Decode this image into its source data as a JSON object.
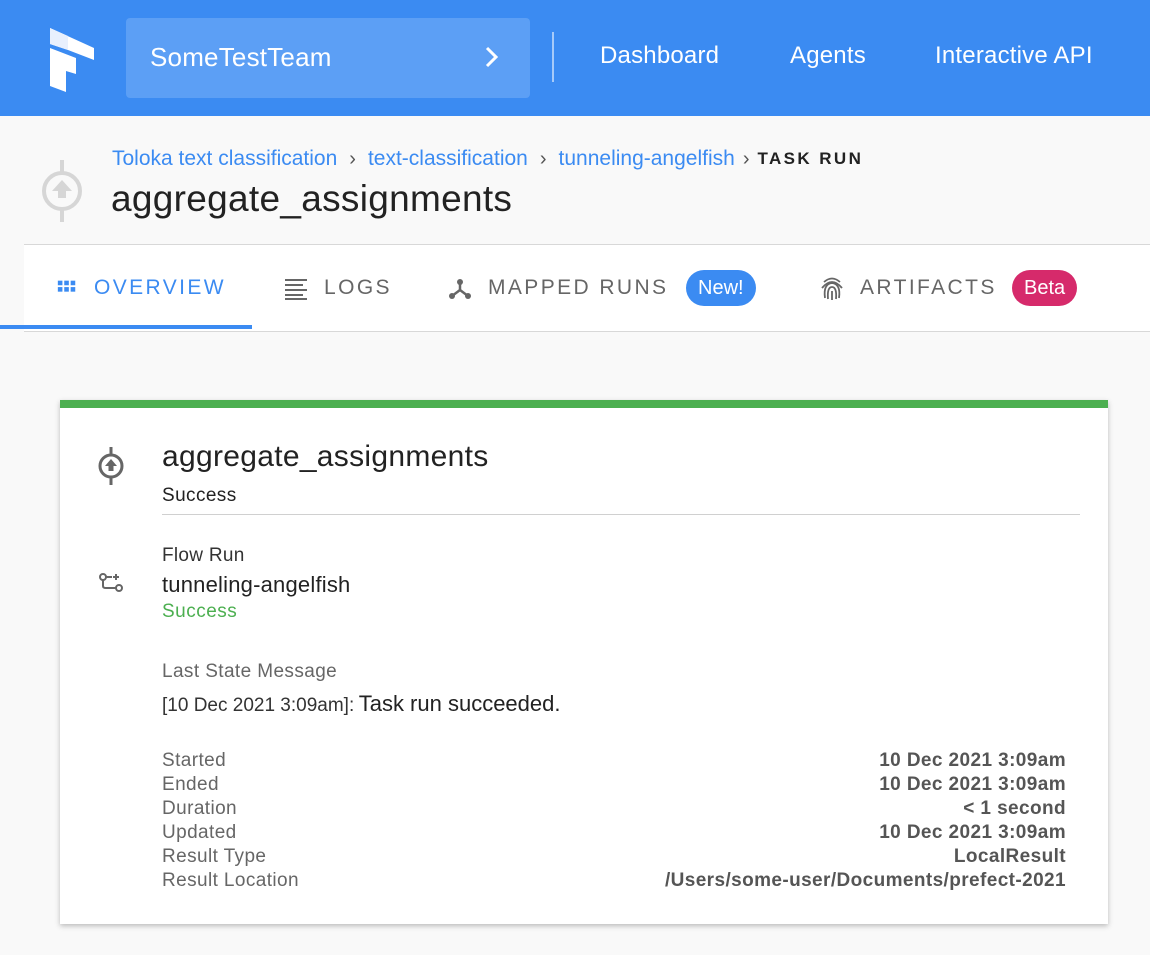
{
  "topbar": {
    "team_name": "SomeTestTeam",
    "nav": [
      "Dashboard",
      "Agents",
      "Interactive API"
    ],
    "icons": {
      "logo": "prefect-logo",
      "team_chevron": "chevron-right-icon"
    }
  },
  "header": {
    "breadcrumb": [
      "Toloka text classification",
      "text-classification",
      "tunneling-angelfish"
    ],
    "current": "TASK RUN",
    "title": "aggregate_assignments"
  },
  "tabs": [
    {
      "label": "OVERVIEW",
      "icon": "grid-icon",
      "active": true
    },
    {
      "label": "LOGS",
      "icon": "lines-icon",
      "active": false
    },
    {
      "label": "MAPPED RUNS",
      "icon": "mapped-icon",
      "badge": "New!",
      "active": false
    },
    {
      "label": "ARTIFACTS",
      "icon": "fingerprint-icon",
      "badge": "Beta",
      "active": false
    }
  ],
  "card": {
    "title": "aggregate_assignments",
    "state": "Success",
    "flow_run_label": "Flow Run",
    "flow_run_name": "tunneling-angelfish",
    "flow_run_state": "Success",
    "last_state_label": "Last State Message",
    "last_state_time": "[10 Dec 2021 3:09am]:",
    "last_state_text": "Task run succeeded.",
    "details": [
      {
        "key": "Started",
        "value": "10 Dec 2021 3:09am"
      },
      {
        "key": "Ended",
        "value": "10 Dec 2021 3:09am"
      },
      {
        "key": "Duration",
        "value": "< 1 second"
      },
      {
        "key": "Updated",
        "value": "10 Dec 2021 3:09am"
      },
      {
        "key": "Result Type",
        "value": "LocalResult"
      },
      {
        "key": "Result Location",
        "value": "/Users/some-user/Documents/prefect-2021"
      }
    ]
  },
  "colors": {
    "primary": "#3b8bf2",
    "success": "#4caf50",
    "beta": "#d62a6b"
  }
}
